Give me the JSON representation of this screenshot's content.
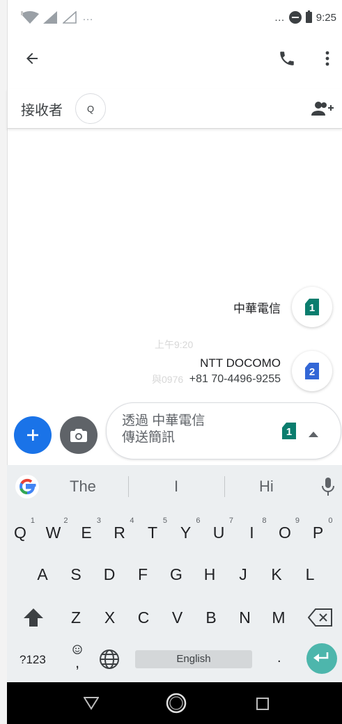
{
  "status_bar": {
    "time": "9:25",
    "left_overflow": "…",
    "right_overflow": "…"
  },
  "toolbar": {
    "back": "back-arrow-icon",
    "call": "phone-icon",
    "more": "more-vert-icon"
  },
  "recipient": {
    "label": "接收者",
    "chip_text": "Q",
    "add_contact_icon": "add-group-icon"
  },
  "sim_options": [
    {
      "carrier": "中華電信",
      "number": "",
      "sim_slot": "1",
      "color": "#0b7d6e"
    },
    {
      "carrier": "NTT DOCOMO",
      "number": "+81 70-4496-9255",
      "sim_slot": "2",
      "color": "#3367d6"
    }
  ],
  "background_text": {
    "time": "上午9:20",
    "number": "與0976"
  },
  "compose": {
    "placeholder_line1": "透過 中華電信",
    "placeholder_line2": "傳送簡訊",
    "sim_slot": "1",
    "sim_color": "#0b7d6e"
  },
  "keyboard": {
    "suggestions": [
      "The",
      "I",
      "Hi"
    ],
    "row1": [
      [
        "Q",
        "1"
      ],
      [
        "W",
        "2"
      ],
      [
        "E",
        "3"
      ],
      [
        "R",
        "4"
      ],
      [
        "T",
        "5"
      ],
      [
        "Y",
        "6"
      ],
      [
        "U",
        "7"
      ],
      [
        "I",
        "8"
      ],
      [
        "O",
        "9"
      ],
      [
        "P",
        "0"
      ]
    ],
    "row2": [
      "A",
      "S",
      "D",
      "F",
      "G",
      "H",
      "J",
      "K",
      "L"
    ],
    "row3": [
      "Z",
      "X",
      "C",
      "V",
      "B",
      "N",
      "M"
    ],
    "symbols_key": "?123",
    "emoji_comma": ",",
    "space_label": "English",
    "period": "."
  },
  "colors": {
    "accent_blue": "#1a73e8",
    "enter_teal": "#4db6ac",
    "keyboard_bg": "#eceff1"
  }
}
